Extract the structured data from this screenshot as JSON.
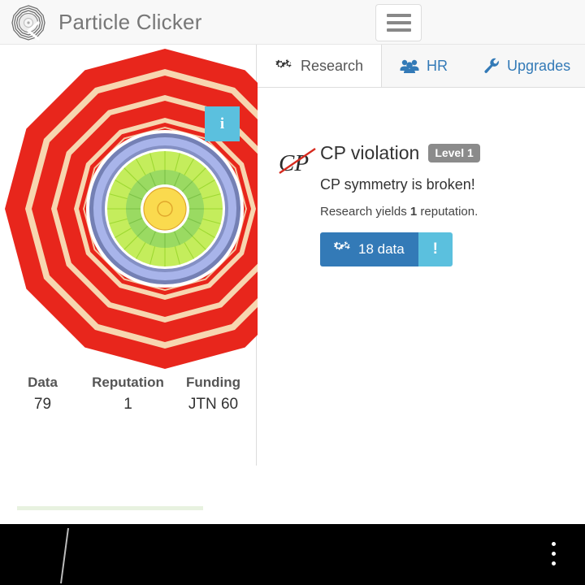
{
  "header": {
    "title": "Particle Clicker",
    "logo_icon": "detector-logo-icon",
    "menu_toggle_icon": "hamburger-icon"
  },
  "detector": {
    "info_button_label": "i",
    "colors": {
      "red": "#e8261c",
      "tan": "#f7d6b0",
      "blue_dark": "#7480b4",
      "blue_light": "#a8b4ea",
      "green_light": "#c4ed5c",
      "green_mid": "#9ada62",
      "yellow": "#fada4e",
      "yellow_stroke": "#e0a72c",
      "info_blue": "#5bc0de"
    }
  },
  "stats": [
    {
      "label": "Data",
      "value": "79"
    },
    {
      "label": "Reputation",
      "value": "1"
    },
    {
      "label": "Funding",
      "value": "JTN 60"
    }
  ],
  "progress": {
    "percent": 100,
    "fill_color": "#e8f2e0"
  },
  "tabs": [
    {
      "label": "Research",
      "icon": "gears-icon",
      "active": true
    },
    {
      "label": "HR",
      "icon": "people-icon",
      "active": false
    },
    {
      "label": "Upgrades",
      "icon": "wrench-icon",
      "active": false
    }
  ],
  "research": {
    "icon": "cp-violation-icon",
    "icon_text": "CP",
    "title": "CP violation",
    "level_badge": "Level 1",
    "description": "CP symmetry is broken!",
    "yield_prefix": "Research yields ",
    "yield_amount": "1",
    "yield_suffix": " reputation.",
    "cost_label": "18 data",
    "cost_icon": "gears-icon",
    "alert_label": "!"
  },
  "bottom_nav": {
    "back_icon": "chevron-left-icon",
    "home_icon": "home-slash-icon",
    "menu_icon": "overflow-dots-icon"
  }
}
